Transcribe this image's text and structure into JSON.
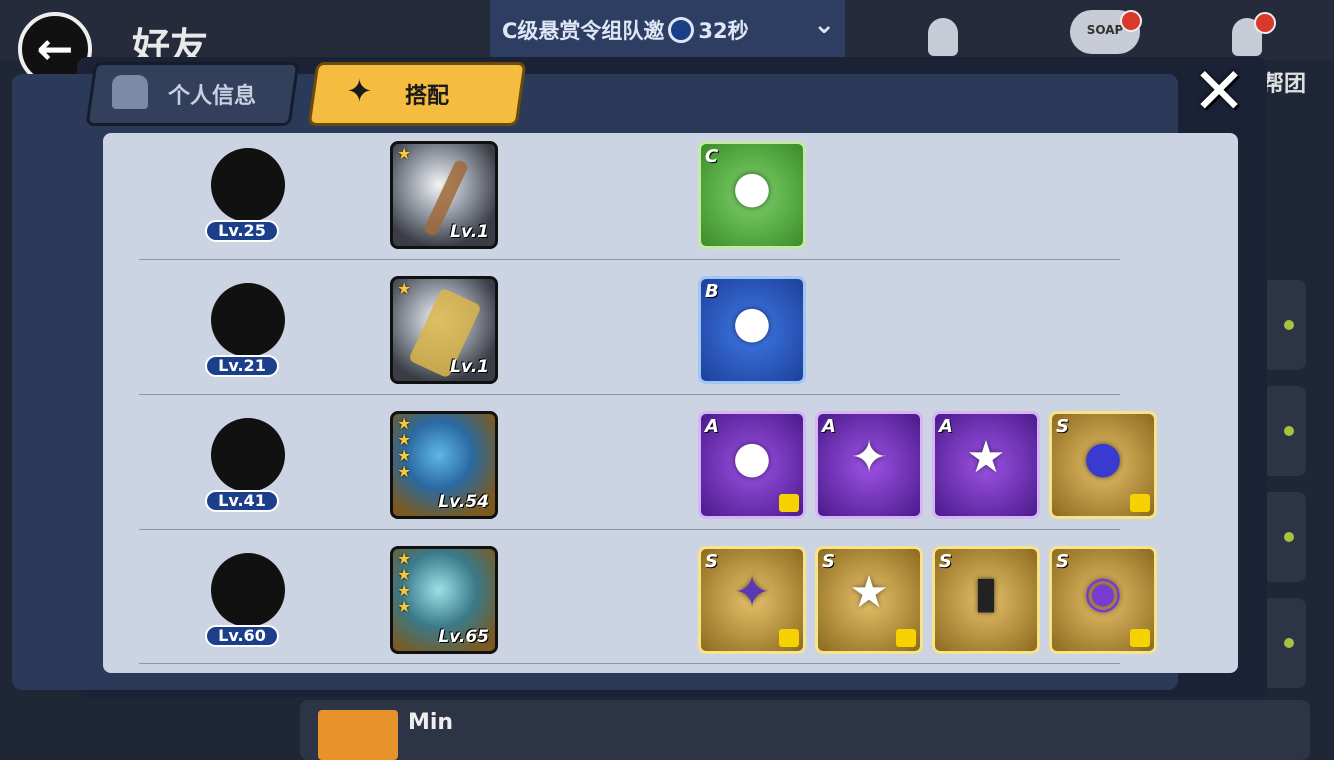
{
  "background": {
    "title": "好友",
    "notice": {
      "text": "C级悬赏令组队邀",
      "timer": "32秒"
    },
    "soap_label": "SOAP",
    "band_label": "帮团",
    "bottom_row_name": "Min"
  },
  "modal": {
    "tabs": [
      {
        "label": "个人信息",
        "active": false
      },
      {
        "label": "搭配",
        "active": true
      }
    ],
    "close_icon": "close-icon"
  },
  "lineup": [
    {
      "level": "Lv.25",
      "weapon": {
        "stars": 1,
        "level": "Lv.1"
      },
      "items": [
        {
          "grade": "C",
          "icon": "lucky-cat-pouch-icon"
        }
      ]
    },
    {
      "level": "Lv.21",
      "weapon": {
        "stars": 1,
        "level": "Lv.1"
      },
      "items": [
        {
          "grade": "B",
          "icon": "lucky-cat-pouch-icon"
        }
      ]
    },
    {
      "level": "Lv.41",
      "weapon": {
        "stars": 4,
        "level": "Lv.54"
      },
      "items": [
        {
          "grade": "A",
          "icon": "daruma-icon",
          "marked": true
        },
        {
          "grade": "A",
          "icon": "shuriken-icon",
          "marked": false
        },
        {
          "grade": "A",
          "icon": "star-drum-icon",
          "marked": false
        },
        {
          "grade": "S",
          "icon": "dark-orb-icon",
          "marked": true
        }
      ]
    },
    {
      "level": "Lv.60",
      "weapon": {
        "stars": 4,
        "level": "Lv.65"
      },
      "items": [
        {
          "grade": "S",
          "icon": "kunai-star-icon",
          "marked": true
        },
        {
          "grade": "S",
          "icon": "star-drum-icon",
          "marked": true
        },
        {
          "grade": "S",
          "icon": "scroll-icon",
          "marked": false
        },
        {
          "grade": "S",
          "icon": "purple-ring-icon",
          "marked": true
        }
      ]
    }
  ]
}
